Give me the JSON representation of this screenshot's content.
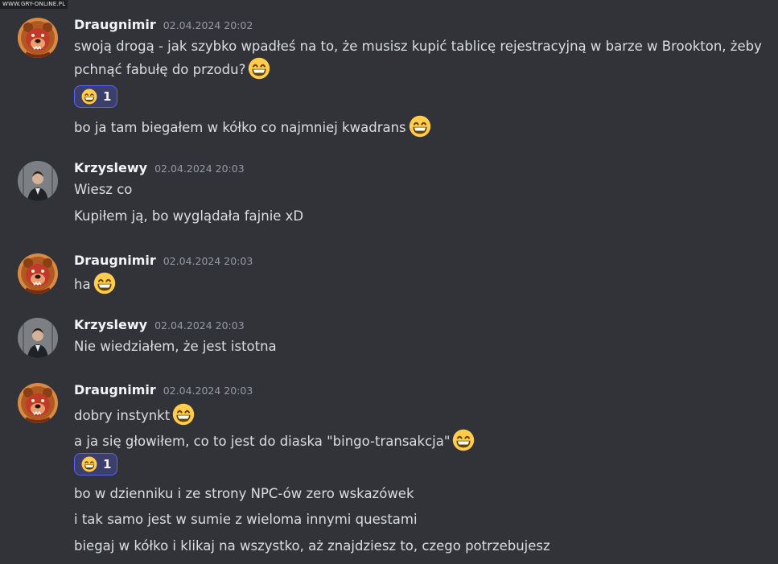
{
  "watermark": "WWW.GRY-ONLINE.PL",
  "icons": {
    "emoji": "grinning-face-emoji",
    "avatar_draugnimir": "bear-avatar",
    "avatar_krzyslewy": "person-avatar"
  },
  "colors": {
    "background": "#313338",
    "username": "#f2f3f5",
    "text": "#dbdee1",
    "timestamp": "#949ba4",
    "reaction_bg": "#3c3f6b",
    "reaction_border": "#5865f2"
  },
  "messages": [
    {
      "author": "Draugnimir",
      "timestamp": "02.04.2024 20:02",
      "lines": [
        "swoją drogą - jak szybko wpadłeś na to, że musisz kupić tablicę rejestracyjną w barze w Brookton, żeby pchnąć fabułę do przodu?",
        "bo ja tam biegałem w kółko co najmniej kwadrans"
      ],
      "reaction": {
        "count": "1"
      }
    },
    {
      "author": "Krzyslewy",
      "timestamp": "02.04.2024 20:03",
      "lines": [
        "Wiesz co",
        "Kupiłem ją, bo wyglądała fajnie xD"
      ]
    },
    {
      "author": "Draugnimir",
      "timestamp": "02.04.2024 20:03",
      "lines": [
        "ha"
      ]
    },
    {
      "author": "Krzyslewy",
      "timestamp": "02.04.2024 20:03",
      "lines": [
        "Nie wiedziałem, że jest istotna"
      ]
    },
    {
      "author": "Draugnimir",
      "timestamp": "02.04.2024 20:03",
      "lines": [
        "dobry instynkt",
        "a ja się głowiłem, co to jest do diaska \"bingo-transakcja\"",
        "bo w dzienniku i ze strony NPC-ów zero wskazówek",
        "i tak samo jest w sumie z wieloma innymi questami",
        "biegaj w kółko i klikaj na wszystko, aż znajdziesz to, czego potrzebujesz"
      ],
      "reaction": {
        "count": "1"
      }
    }
  ]
}
